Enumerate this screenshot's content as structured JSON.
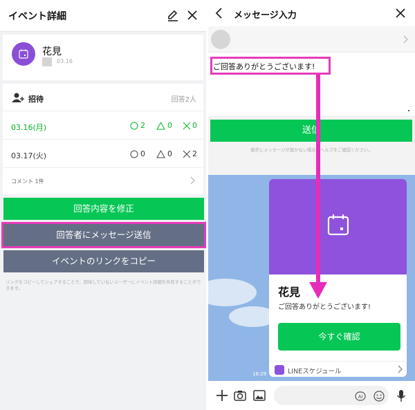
{
  "left": {
    "header": {
      "title": "イベント詳細",
      "edit_icon": "pencil-icon",
      "close_icon": "close-icon"
    },
    "event": {
      "name": "花見",
      "date": "03.16",
      "avatar_color": "#8b4fd6"
    },
    "invite": {
      "label": "招待",
      "count": "回答2人",
      "rows": [
        {
          "date": "03.16(月)",
          "yes": "2",
          "maybe": "0",
          "no": "0",
          "highlight": true
        },
        {
          "date": "03.17(火)",
          "yes": "0",
          "maybe": "0",
          "no": "2",
          "highlight": false
        }
      ],
      "comment_label": "コメント 1件"
    },
    "buttons": {
      "edit_answer": "回答内容を修正",
      "message_respondents": "回答者にメッセージ送信",
      "copy_link": "イベントのリンクをコピー"
    },
    "note": "リンクをコピーしてシェアすることで、招待していないユーザーにイベント詳細を共有することができます。",
    "colors": {
      "green": "#06c755",
      "grey_button": "#646f85",
      "highlight": "#e73bb9"
    }
  },
  "right": {
    "header": {
      "title": "メッセージ入力",
      "back_icon": "back-chevron-icon",
      "close_icon": "close-icon"
    },
    "message_text": "ご回答ありがとうございます!",
    "send_label": "送信",
    "send_note": "相手にメッセージが届かない場合はヘルプをご確認ください。",
    "card": {
      "name": "花見",
      "subtitle": "ご回答ありがとうございます!",
      "confirm_button": "今すぐ確認",
      "footer": "LINEスケジュール",
      "color": "#8e52dc"
    },
    "time": "16:29",
    "input_bar": {
      "icons": [
        "plus-icon",
        "camera-icon",
        "image-icon",
        "ai-icon",
        "emoji-icon",
        "mic-icon"
      ]
    }
  }
}
